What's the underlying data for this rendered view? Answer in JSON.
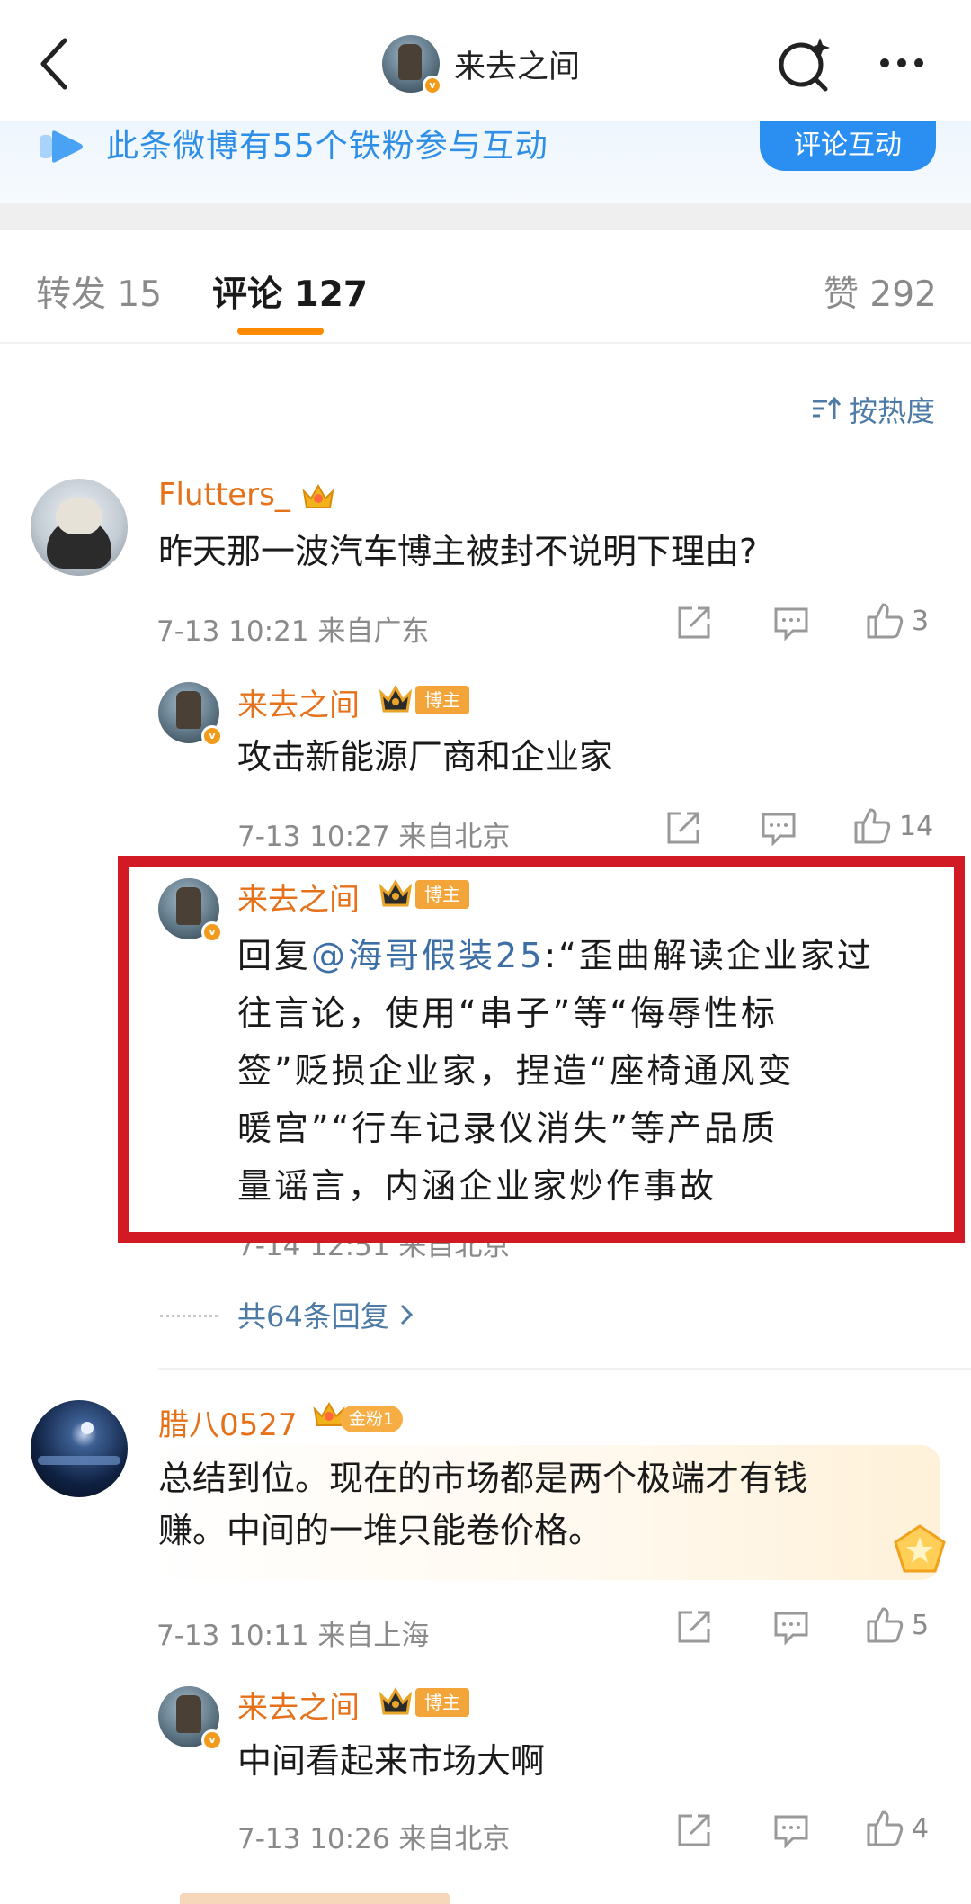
{
  "header": {
    "title": "来去之间"
  },
  "banner": {
    "text": "此条微博有55个铁粉参与互动",
    "button_label": "评论互动"
  },
  "tabs": [
    {
      "label": "转发 15"
    },
    {
      "label": "评论 127"
    },
    {
      "label": "赞 292"
    }
  ],
  "sort": {
    "label": "按热度"
  },
  "comments": [
    {
      "user": "Flutters_",
      "text": "昨天那一波汽车博主被封不说明下理由?",
      "meta": "7-13 10:21 来自广东",
      "likes": "3",
      "replies": [
        {
          "user": "来去之间",
          "tag": "博主",
          "text": "攻击新能源厂商和企业家",
          "meta": "7-13 10:27 来自北京",
          "likes": "14"
        },
        {
          "user": "来去之间",
          "tag": "博主",
          "reply_prefix": "回复",
          "mention": "@海哥假装25",
          "text_line1": ":“歪曲解读企业家过",
          "text_line2": "往言论，使用“串子”等“侮辱性标",
          "text_line3": "签”贬损企业家，捏造“座椅通风变",
          "text_line4": "暖宫”“行车记录仪消失”等产品质",
          "text_line5": "量谣言，内涵企业家炒作事故",
          "meta": "7-14 12:51 来自北京"
        }
      ],
      "reply_count_label": "共64条回复"
    },
    {
      "user": "腊八0527",
      "tag": "金粉1",
      "text_line1": "总结到位。现在的市场都是两个极端才有钱",
      "text_line2": "赚。中间的一堆只能卷价格。",
      "meta": "7-13 10:11 来自上海",
      "likes": "5",
      "replies": [
        {
          "user": "来去之间",
          "tag": "博主",
          "text": "中间看起来市场大啊",
          "meta": "7-13 10:26 来自北京",
          "likes": "4"
        }
      ]
    }
  ],
  "colors": {
    "username": "#e5711a",
    "link": "#4e7ba6",
    "accent_underline": "#ff8a00",
    "highlight_box": "#d21a25",
    "banner_blue": "#2a8ff0"
  },
  "icons": [
    "back-arrow-icon",
    "search-icon",
    "more-icon",
    "share-icon",
    "comment-icon",
    "like-icon",
    "crown-icon",
    "verified-icon"
  ]
}
